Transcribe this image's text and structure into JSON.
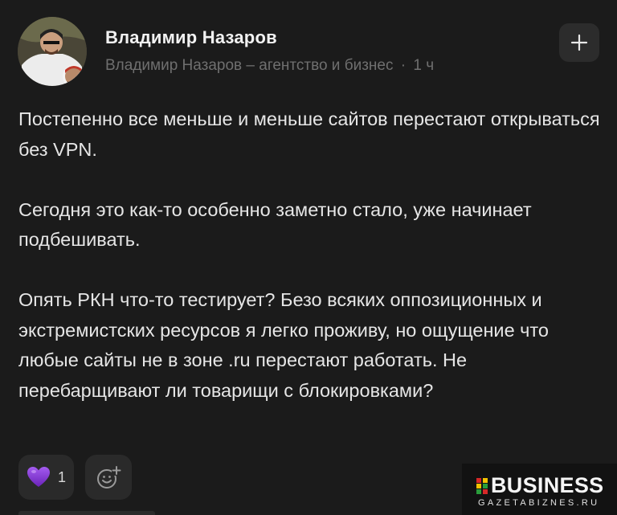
{
  "author": {
    "name": "Владимир Назаров",
    "channel": "Владимир Назаров – агентство и бизнес",
    "separator": "·",
    "time": "1 ч"
  },
  "post": {
    "paragraphs": [
      "Постепенно все меньше и меньше сайтов перестают открываться без VPN.",
      "Сегодня это как-то особенно заметно стало, уже начинает подбешивать.",
      "Опять РКН что-то тестирует? Безо всяких оппозиционных и экстремистских ресурсов я легко проживу, но ощущение что любые сайты не в зоне .ru перестают работать. Не перебарщивают ли товарищи с блокировками?"
    ]
  },
  "reactions": {
    "emoji": "purple-heart-icon",
    "count": "1"
  },
  "icons": {
    "plus": "plus-icon",
    "add_reaction": "add-reaction-icon"
  },
  "watermark": {
    "title": "BUSINESS",
    "subtitle": "GAZETABIZNES.RU"
  },
  "colors": {
    "background": "#1b1b1b",
    "text": "#e6e6e6",
    "muted": "#6f6f6f",
    "button_bg": "#2c2c2c",
    "heart": "#8b3fd6"
  }
}
